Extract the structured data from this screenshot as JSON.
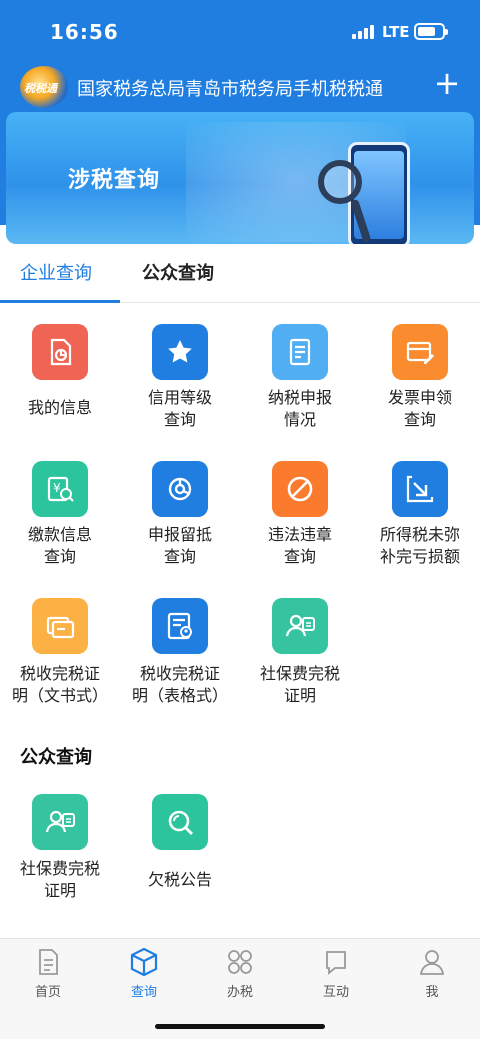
{
  "status": {
    "time": "16:56",
    "network": "LTE"
  },
  "header": {
    "title": "国家税务总局青岛市税务局手机税税通",
    "logo_text": "税税通"
  },
  "banner": {
    "text": "涉税查询"
  },
  "tabs": [
    {
      "label": "企业查询"
    },
    {
      "label": "公众查询"
    }
  ],
  "items": [
    {
      "label_1": "我的信息",
      "label_2": "",
      "icon": "my-info-icon",
      "color": "#f06454"
    },
    {
      "label_1": "信用等级",
      "label_2": "查询",
      "icon": "star-icon",
      "color": "#1f7ee0"
    },
    {
      "label_1": "纳税申报",
      "label_2": "情况",
      "icon": "report-icon",
      "color": "#52aef3"
    },
    {
      "label_1": "发票申领",
      "label_2": "查询",
      "icon": "invoice-icon",
      "color": "#fa8b2e"
    },
    {
      "label_1": "缴款信息",
      "label_2": "查询",
      "icon": "payment-icon",
      "color": "#2bc49c"
    },
    {
      "label_1": "申报留抵",
      "label_2": "查询",
      "icon": "offset-icon",
      "color": "#1f7ee0"
    },
    {
      "label_1": "违法违章",
      "label_2": "查询",
      "icon": "violation-icon",
      "color": "#fa7a2e"
    },
    {
      "label_1": "所得税未弥",
      "label_2": "补完亏损额",
      "icon": "loss-icon",
      "color": "#1f7ee0"
    },
    {
      "label_1": "税收完税证",
      "label_2": "明（文书式）",
      "icon": "certificate-card-icon",
      "color": "#fbb144"
    },
    {
      "label_1": "税收完税证",
      "label_2": "明（表格式）",
      "icon": "certificate-table-icon",
      "color": "#1f7ee0"
    },
    {
      "label_1": "社保费完税",
      "label_2": "证明",
      "icon": "social-security-icon",
      "color": "#36c3a0"
    }
  ],
  "public_section": {
    "title": "公众查询"
  },
  "public_items": [
    {
      "label_1": "社保费完税",
      "label_2": "证明",
      "icon": "social-security-icon",
      "color": "#36c3a0"
    },
    {
      "label_1": "欠税公告",
      "label_2": "",
      "icon": "search-icon",
      "color": "#2bc49c"
    }
  ],
  "bottom_nav": [
    {
      "label": "首页",
      "icon": "home-icon"
    },
    {
      "label": "查询",
      "icon": "query-icon"
    },
    {
      "label": "办税",
      "icon": "apps-icon"
    },
    {
      "label": "互动",
      "icon": "interact-icon"
    },
    {
      "label": "我",
      "icon": "user-icon"
    }
  ]
}
